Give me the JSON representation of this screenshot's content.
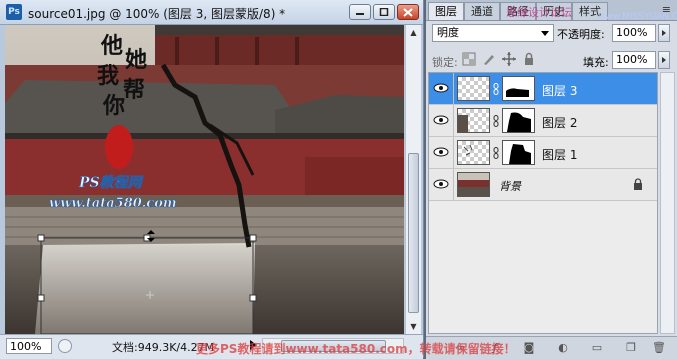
{
  "document": {
    "app_icon": "Ps",
    "title": "source01.jpg @ 100% (图层 3, 图层蒙版/8) *",
    "zoom": "100%",
    "doc_info": "文档:949.3K/4.27M",
    "canvas_calligraphy": [
      "他",
      "她",
      "我",
      "帮",
      "你"
    ],
    "canvas_site_name": "PS教程网",
    "canvas_url": "www.tata580.com"
  },
  "panel": {
    "tabs": [
      "图层",
      "通道",
      "路径",
      "历史",
      "样式"
    ],
    "active_tab": 0,
    "blend_mode": "明度",
    "opacity_label": "不透明度:",
    "opacity_value": "100%",
    "lock_label": "锁定:",
    "fill_label": "填充:",
    "fill_value": "100%",
    "layers": [
      {
        "name": "图层 3",
        "selected": true,
        "has_mask": true
      },
      {
        "name": "图层 2",
        "selected": false,
        "has_mask": true
      },
      {
        "name": "图层 1",
        "selected": false,
        "has_mask": true
      },
      {
        "name": "背景",
        "selected": false,
        "has_mask": false,
        "locked": true
      }
    ]
  },
  "watermarks": {
    "top": "思缘设计论坛",
    "top_url": "www.MISSYUAN.COM",
    "bottom": "更多PS教程请到www.tata580.com，转载请保留链接！"
  },
  "colors": {
    "selection_blue": "#3d8ee6",
    "panel_bg": "#d8dde5",
    "close_red": "#c9442a"
  }
}
